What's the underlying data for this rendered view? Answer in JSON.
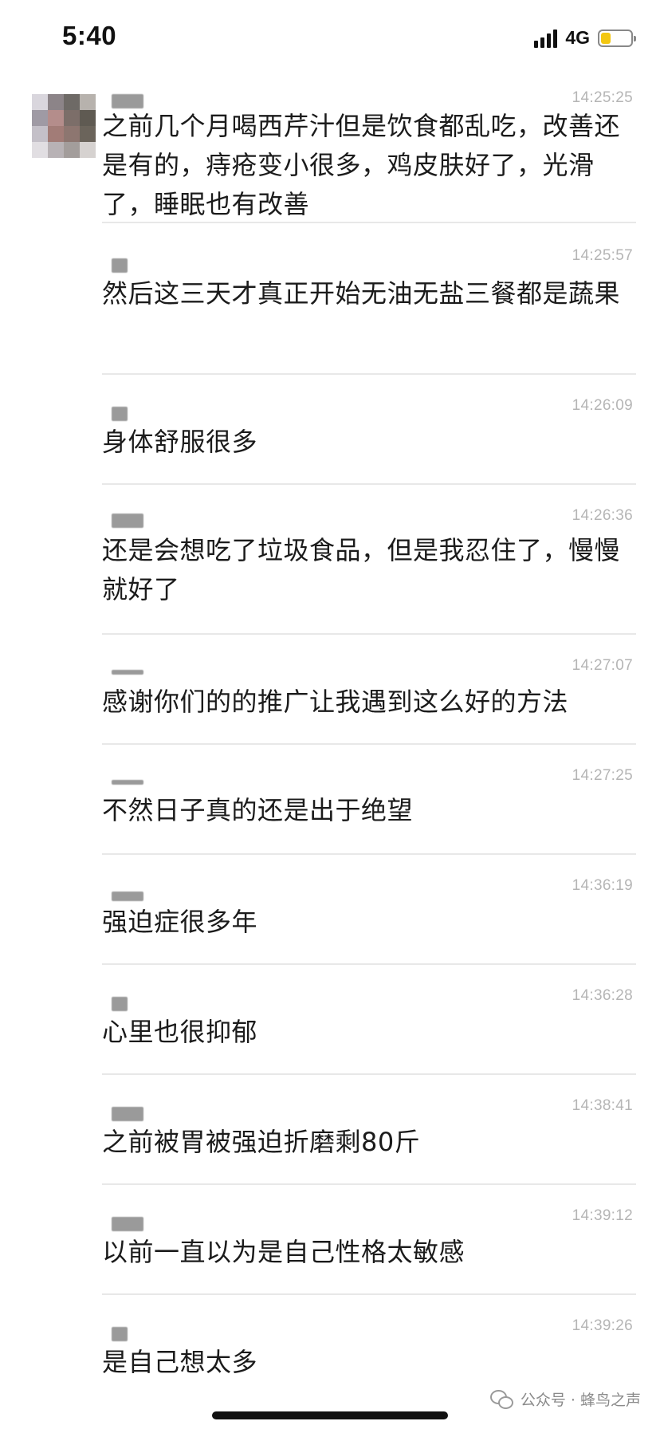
{
  "status_bar": {
    "time": "5:40",
    "network": "4G",
    "battery_color": "#f3c712"
  },
  "messages": [
    {
      "time": "14:25:25",
      "text": "之前几个月喝西芹汁但是饮食都乱吃，改善还是有的，痔疮变小很多，鸡皮肤好了，光滑了，睡眠也有改善"
    },
    {
      "time": "14:25:57",
      "text": "然后这三天才真正开始无油无盐三餐都是蔬果"
    },
    {
      "time": "14:26:09",
      "text": "身体舒服很多"
    },
    {
      "time": "14:26:36",
      "text": "还是会想吃了垃圾食品，但是我忍住了，慢慢就好了"
    },
    {
      "time": "14:27:07",
      "text": "感谢你们的的推广让我遇到这么好的方法"
    },
    {
      "time": "14:27:25",
      "text": "不然日子真的还是出于绝望"
    },
    {
      "time": "14:36:19",
      "text": "强迫症很多年"
    },
    {
      "time": "14:36:28",
      "text": "心里也很抑郁"
    },
    {
      "time": "14:38:41",
      "text": "之前被胃被强迫折磨剩80斤"
    },
    {
      "time": "14:39:12",
      "text": "以前一直以为是自己性格太敏感"
    },
    {
      "time": "14:39:26",
      "text": "是自己想太多"
    }
  ],
  "watermark": {
    "icon": "wechat-icon",
    "text": "公众号 · 蜂鸟之声"
  }
}
